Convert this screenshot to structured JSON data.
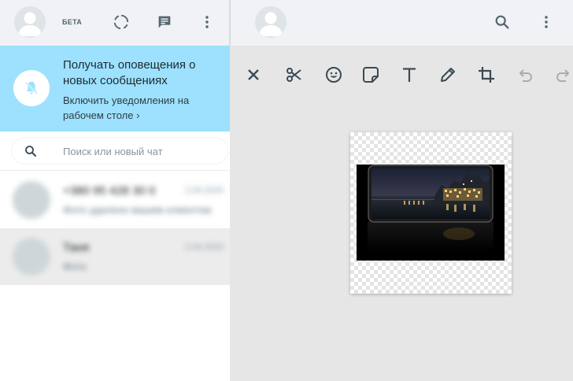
{
  "header": {
    "beta_label": "БЕТА"
  },
  "notification": {
    "title": "Получать оповещения о новых сообщениях",
    "link_text": "Включить уведомления на рабочем столе ›"
  },
  "search": {
    "placeholder": "Поиск или новый чат"
  },
  "chats": [
    {
      "name": "+380 95 428 30 0",
      "time": "2.04.2020",
      "preview": "Фото удалено вашим клиентом"
    },
    {
      "name": "Таня",
      "time": "2.04.2020",
      "preview": "Фото"
    }
  ],
  "editor": {
    "tools": [
      "close-icon",
      "scissors-icon",
      "emoji-icon",
      "sticker-icon",
      "text-icon",
      "pencil-icon",
      "crop-icon",
      "undo-icon",
      "redo-icon"
    ]
  },
  "colors": {
    "notification_bg": "#9de1fe",
    "header_bg": "#f0f2f5",
    "editor_bg": "#e6e6e6",
    "icon": "#54656f"
  }
}
